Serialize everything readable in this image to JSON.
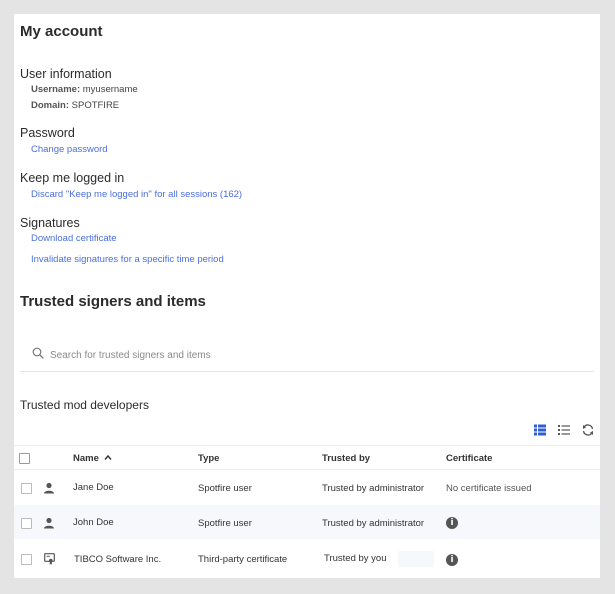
{
  "page": {
    "title": "My account"
  },
  "user_info": {
    "title": "User information",
    "username_label": "Username:",
    "username_value": "myusername",
    "domain_label": "Domain:",
    "domain_value": "SPOTFIRE"
  },
  "password": {
    "title": "Password",
    "change_link": "Change password"
  },
  "keep_logged_in": {
    "title": "Keep me logged in",
    "discard_link": "Discard \"Keep me logged in\" for all sessions (162)"
  },
  "signatures": {
    "title": "Signatures",
    "download_link": "Download certificate",
    "invalidate_link": "Invalidate signatures for a specific time period"
  },
  "trusted": {
    "title": "Trusted signers and items",
    "search_placeholder": "Search for trusted signers and items",
    "list_title": "Trusted mod developers",
    "columns": {
      "name": "Name",
      "type": "Type",
      "trusted_by": "Trusted by",
      "certificate": "Certificate"
    },
    "sort_indicator": "^",
    "rows": [
      {
        "name": "Jane Doe",
        "type": "Spotfire user",
        "trusted_by": "Trusted by administrator",
        "certificate": "No certificate issued",
        "icon": "user-icon"
      },
      {
        "name": "John Doe",
        "type": "Spotfire user",
        "trusted_by": "Trusted by administrator",
        "certificate": "",
        "icon": "user-icon"
      },
      {
        "name": "TIBCO Software Inc.",
        "type": "Third-party certificate",
        "trusted_by": "Trusted by you",
        "certificate": "",
        "icon": "certificate-icon"
      }
    ],
    "info_glyph": "i"
  },
  "colors": {
    "link": "#4a6fdc",
    "accent": "#2f5fd0",
    "text": "#2b2b2b"
  }
}
